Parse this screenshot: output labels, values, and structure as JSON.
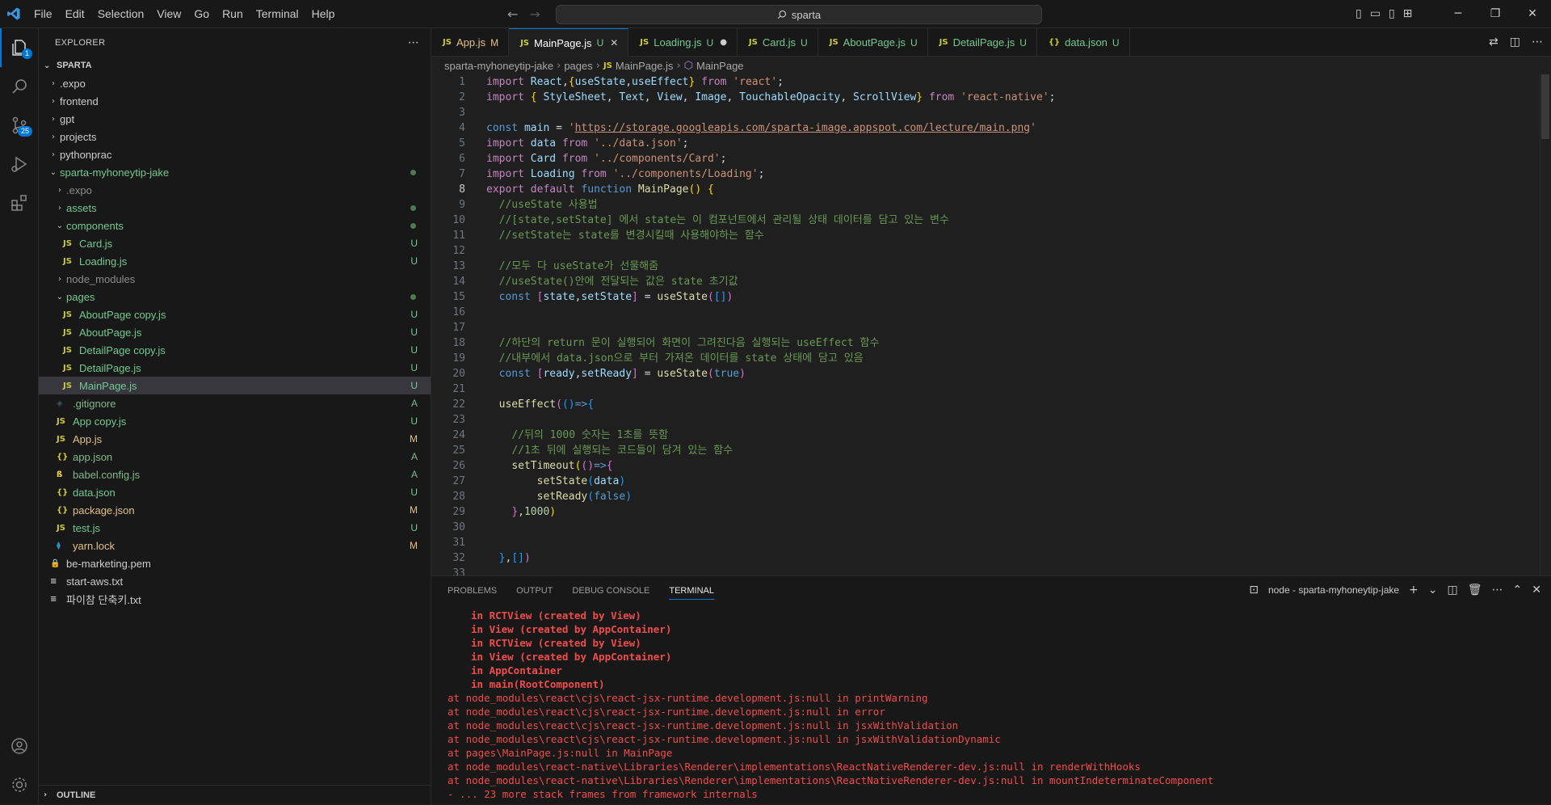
{
  "menu": [
    "File",
    "Edit",
    "Selection",
    "View",
    "Go",
    "Run",
    "Terminal",
    "Help"
  ],
  "search": {
    "text": "sparta"
  },
  "explorer": {
    "title": "EXPLORER",
    "root": "SPARTA",
    "items": [
      {
        "label": ".expo",
        "type": "folder",
        "open": false,
        "depth": 1,
        "color": "#cccccc"
      },
      {
        "label": "frontend",
        "type": "folder",
        "open": false,
        "depth": 1,
        "color": "#cccccc"
      },
      {
        "label": "gpt",
        "type": "folder",
        "open": false,
        "depth": 1,
        "color": "#cccccc"
      },
      {
        "label": "projects",
        "type": "folder",
        "open": false,
        "depth": 1,
        "color": "#cccccc"
      },
      {
        "label": "pythonprac",
        "type": "folder",
        "open": false,
        "depth": 1,
        "color": "#cccccc"
      },
      {
        "label": "sparta-myhoneytip-jake",
        "type": "folder",
        "open": true,
        "depth": 1,
        "color": "#73c991",
        "dot": true
      },
      {
        "label": ".expo",
        "type": "folder",
        "open": false,
        "depth": 2,
        "color": "#8c8c8c"
      },
      {
        "label": "assets",
        "type": "folder",
        "open": false,
        "depth": 2,
        "color": "#73c991",
        "dot": true
      },
      {
        "label": "components",
        "type": "folder",
        "open": true,
        "depth": 2,
        "color": "#73c991",
        "dot": true
      },
      {
        "label": "Card.js",
        "type": "js",
        "depth": 3,
        "color": "#73c991",
        "status": "U"
      },
      {
        "label": "Loading.js",
        "type": "js",
        "depth": 3,
        "color": "#73c991",
        "status": "U"
      },
      {
        "label": "node_modules",
        "type": "folder",
        "open": false,
        "depth": 2,
        "color": "#8c8c8c"
      },
      {
        "label": "pages",
        "type": "folder",
        "open": true,
        "depth": 2,
        "color": "#73c991",
        "dot": true
      },
      {
        "label": "AboutPage copy.js",
        "type": "js",
        "depth": 3,
        "color": "#73c991",
        "status": "U"
      },
      {
        "label": "AboutPage.js",
        "type": "js",
        "depth": 3,
        "color": "#73c991",
        "status": "U"
      },
      {
        "label": "DetailPage copy.js",
        "type": "js",
        "depth": 3,
        "color": "#73c991",
        "status": "U"
      },
      {
        "label": "DetailPage.js",
        "type": "js",
        "depth": 3,
        "color": "#73c991",
        "status": "U"
      },
      {
        "label": "MainPage.js",
        "type": "js",
        "depth": 3,
        "color": "#73c991",
        "status": "U",
        "selected": true
      },
      {
        "label": ".gitignore",
        "type": "git",
        "depth": 2,
        "color": "#81b88b",
        "status": "A"
      },
      {
        "label": "App copy.js",
        "type": "js",
        "depth": 2,
        "color": "#73c991",
        "status": "U"
      },
      {
        "label": "App.js",
        "type": "js",
        "depth": 2,
        "color": "#e2c08d",
        "status": "M"
      },
      {
        "label": "app.json",
        "type": "json",
        "depth": 2,
        "color": "#81b88b",
        "status": "A"
      },
      {
        "label": "babel.config.js",
        "type": "babel",
        "depth": 2,
        "color": "#81b88b",
        "status": "A"
      },
      {
        "label": "data.json",
        "type": "json",
        "depth": 2,
        "color": "#73c991",
        "status": "U"
      },
      {
        "label": "package.json",
        "type": "json",
        "depth": 2,
        "color": "#e2c08d",
        "status": "M"
      },
      {
        "label": "test.js",
        "type": "js",
        "depth": 2,
        "color": "#73c991",
        "status": "U"
      },
      {
        "label": "yarn.lock",
        "type": "yarn",
        "depth": 2,
        "color": "#e2c08d",
        "status": "M"
      },
      {
        "label": "be-marketing.pem",
        "type": "pem",
        "depth": 1,
        "color": "#cccccc"
      },
      {
        "label": "start-aws.txt",
        "type": "txt",
        "depth": 1,
        "color": "#cccccc"
      },
      {
        "label": "파이참 단축키.txt",
        "type": "txt",
        "depth": 1,
        "color": "#cccccc"
      }
    ],
    "outline": "OUTLINE"
  },
  "tabs": [
    {
      "label": "App.js",
      "status": "M",
      "type": "js",
      "color": "#e2c08d"
    },
    {
      "label": "MainPage.js",
      "status": "U",
      "type": "js",
      "color": "#73c991",
      "active": true
    },
    {
      "label": "Loading.js",
      "status": "U",
      "type": "js",
      "color": "#73c991",
      "dirty": true
    },
    {
      "label": "Card.js",
      "status": "U",
      "type": "js",
      "color": "#73c991"
    },
    {
      "label": "AboutPage.js",
      "status": "U",
      "type": "js",
      "color": "#73c991"
    },
    {
      "label": "DetailPage.js",
      "status": "U",
      "type": "js",
      "color": "#73c991"
    },
    {
      "label": "data.json",
      "status": "U",
      "type": "json",
      "color": "#73c991"
    }
  ],
  "breadcrumb": {
    "folder": "sparta-myhoneytip-jake",
    "sub": "pages",
    "file": "MainPage.js",
    "symbol": "MainPage"
  },
  "code_lines": [
    [
      [
        "kc",
        "import "
      ],
      [
        "var",
        "React"
      ],
      [
        "pl",
        ","
      ],
      [
        "br1",
        "{"
      ],
      [
        "var",
        "useState"
      ],
      [
        "pl",
        ","
      ],
      [
        "var",
        "useEffect"
      ],
      [
        "br1",
        "}"
      ],
      [
        "kc",
        " from "
      ],
      [
        "str",
        "'react'"
      ],
      [
        "pl",
        ";"
      ]
    ],
    [
      [
        "kc",
        "import "
      ],
      [
        "br1",
        "{ "
      ],
      [
        "var",
        "StyleSheet"
      ],
      [
        "pl",
        ", "
      ],
      [
        "var",
        "Text"
      ],
      [
        "pl",
        ", "
      ],
      [
        "var",
        "View"
      ],
      [
        "pl",
        ", "
      ],
      [
        "var",
        "Image"
      ],
      [
        "pl",
        ", "
      ],
      [
        "var",
        "TouchableOpacity"
      ],
      [
        "pl",
        ", "
      ],
      [
        "var",
        "ScrollView"
      ],
      [
        "br1",
        "}"
      ],
      [
        "kc",
        " from "
      ],
      [
        "str",
        "'react-native'"
      ],
      [
        "pl",
        ";"
      ]
    ],
    [],
    [
      [
        "kw",
        "const "
      ],
      [
        "var",
        "main"
      ],
      [
        "pl",
        " = "
      ],
      [
        "str",
        "'"
      ],
      [
        "url",
        "https://storage.googleapis.com/sparta-image.appspot.com/lecture/main.png"
      ],
      [
        "str",
        "'"
      ]
    ],
    [
      [
        "kc",
        "import "
      ],
      [
        "var",
        "data"
      ],
      [
        "kc",
        " from "
      ],
      [
        "str",
        "'../data.json'"
      ],
      [
        "pl",
        ";"
      ]
    ],
    [
      [
        "kc",
        "import "
      ],
      [
        "var",
        "Card"
      ],
      [
        "kc",
        " from "
      ],
      [
        "str",
        "'../components/Card'"
      ],
      [
        "pl",
        ";"
      ]
    ],
    [
      [
        "kc",
        "import "
      ],
      [
        "var",
        "Loading"
      ],
      [
        "kc",
        " from "
      ],
      [
        "str",
        "'../components/Loading'"
      ],
      [
        "pl",
        ";"
      ]
    ],
    [
      [
        "kc",
        "export "
      ],
      [
        "kc",
        "default "
      ],
      [
        "kw",
        "function "
      ],
      [
        "fn",
        "MainPage"
      ],
      [
        "br1",
        "() {"
      ]
    ],
    [
      [
        "pl",
        "  "
      ],
      [
        "cm",
        "//useState 사용법"
      ]
    ],
    [
      [
        "pl",
        "  "
      ],
      [
        "cm",
        "//[state,setState] 에서 state는 이 컴포넌트에서 관리될 상태 데이터를 담고 있는 변수"
      ]
    ],
    [
      [
        "pl",
        "  "
      ],
      [
        "cm",
        "//setState는 state를 변경시킬때 사용해야하는 함수"
      ]
    ],
    [],
    [
      [
        "pl",
        "  "
      ],
      [
        "cm",
        "//모두 다 useState가 선물해줌"
      ]
    ],
    [
      [
        "pl",
        "  "
      ],
      [
        "cm",
        "//useState()안에 전달되는 값은 state 초기값"
      ]
    ],
    [
      [
        "pl",
        "  "
      ],
      [
        "kw",
        "const "
      ],
      [
        "br2",
        "["
      ],
      [
        "var",
        "state"
      ],
      [
        "pl",
        ","
      ],
      [
        "var",
        "setState"
      ],
      [
        "br2",
        "]"
      ],
      [
        "pl",
        " = "
      ],
      [
        "fn",
        "useState"
      ],
      [
        "br2",
        "("
      ],
      [
        "br3",
        "[]"
      ],
      [
        "br2",
        ")"
      ]
    ],
    [],
    [],
    [
      [
        "pl",
        "  "
      ],
      [
        "cm",
        "//하단의 return 문이 실행되어 화면이 그려진다음 실행되는 useEffect 함수"
      ]
    ],
    [
      [
        "pl",
        "  "
      ],
      [
        "cm",
        "//내부에서 data.json으로 부터 가져온 데이터를 state 상태에 담고 있음"
      ]
    ],
    [
      [
        "pl",
        "  "
      ],
      [
        "kw",
        "const "
      ],
      [
        "br2",
        "["
      ],
      [
        "var",
        "ready"
      ],
      [
        "pl",
        ","
      ],
      [
        "var",
        "setReady"
      ],
      [
        "br2",
        "]"
      ],
      [
        "pl",
        " = "
      ],
      [
        "fn",
        "useState"
      ],
      [
        "br2",
        "("
      ],
      [
        "kw",
        "true"
      ],
      [
        "br2",
        ")"
      ]
    ],
    [],
    [
      [
        "pl",
        "  "
      ],
      [
        "fn",
        "useEffect"
      ],
      [
        "br2",
        "("
      ],
      [
        "br3",
        "()"
      ],
      [
        "kw",
        "=>"
      ],
      [
        "br3",
        "{"
      ]
    ],
    [],
    [
      [
        "pl",
        "    "
      ],
      [
        "cm",
        "//뒤의 1000 숫자는 1초를 뜻함"
      ]
    ],
    [
      [
        "pl",
        "    "
      ],
      [
        "cm",
        "//1초 뒤에 실행되는 코드들이 담겨 있는 함수"
      ]
    ],
    [
      [
        "pl",
        "    "
      ],
      [
        "fn",
        "setTimeout"
      ],
      [
        "br1",
        "("
      ],
      [
        "br2",
        "()"
      ],
      [
        "kw",
        "=>"
      ],
      [
        "br2",
        "{"
      ]
    ],
    [
      [
        "pl",
        "        "
      ],
      [
        "fn",
        "setState"
      ],
      [
        "br3",
        "("
      ],
      [
        "var",
        "data"
      ],
      [
        "br3",
        ")"
      ]
    ],
    [
      [
        "pl",
        "        "
      ],
      [
        "fn",
        "setReady"
      ],
      [
        "br3",
        "("
      ],
      [
        "kw",
        "false"
      ],
      [
        "br3",
        ")"
      ]
    ],
    [
      [
        "pl",
        "    "
      ],
      [
        "br2",
        "}"
      ],
      [
        "pl",
        ","
      ],
      [
        "num",
        "1000"
      ],
      [
        "br1",
        ")"
      ]
    ],
    [],
    [],
    [
      [
        "pl",
        "  "
      ],
      [
        "br3",
        "}"
      ],
      [
        "pl",
        ","
      ],
      [
        "br3",
        "[]"
      ],
      [
        "br2",
        ")"
      ]
    ],
    []
  ],
  "current_line": 8,
  "panel": {
    "tabs": [
      "PROBLEMS",
      "OUTPUT",
      "DEBUG CONSOLE",
      "TERMINAL"
    ],
    "active_tab": "TERMINAL",
    "terminal_name": "node - sparta-myhoneytip-jake",
    "lines": [
      {
        "text": "in RCTView (created by View)",
        "bold": true
      },
      {
        "text": "in View (created by AppContainer)",
        "bold": true
      },
      {
        "text": "in RCTView (created by View)",
        "bold": true
      },
      {
        "text": "in View (created by AppContainer)",
        "bold": true
      },
      {
        "text": "in AppContainer",
        "bold": true
      },
      {
        "text": "in main(RootComponent)",
        "bold": true
      },
      {
        "text": "at node_modules\\react\\cjs\\react-jsx-runtime.development.js:null in printWarning",
        "bold": false
      },
      {
        "text": "at node_modules\\react\\cjs\\react-jsx-runtime.development.js:null in error",
        "bold": false
      },
      {
        "text": "at node_modules\\react\\cjs\\react-jsx-runtime.development.js:null in jsxWithValidation",
        "bold": false
      },
      {
        "text": "at node_modules\\react\\cjs\\react-jsx-runtime.development.js:null in jsxWithValidationDynamic",
        "bold": false
      },
      {
        "text": "at pages\\MainPage.js:null in MainPage",
        "bold": false
      },
      {
        "text": "at node_modules\\react-native\\Libraries\\Renderer\\implementations\\ReactNativeRenderer-dev.js:null in renderWithHooks",
        "bold": false
      },
      {
        "text": "at node_modules\\react-native\\Libraries\\Renderer\\implementations\\ReactNativeRenderer-dev.js:null in mountIndeterminateComponent",
        "bold": false
      },
      {
        "text": "- ... 23 more stack frames from framework internals",
        "bold": false
      }
    ]
  },
  "badges": {
    "explorer": "1",
    "scm": "25"
  }
}
